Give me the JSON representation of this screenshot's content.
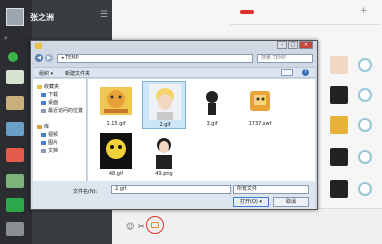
{
  "messenger": {
    "user_name": "张之洲",
    "menu_glyph": "☰",
    "search_glyph": "⌕",
    "add_glyph": "+",
    "footer_glyphs": {
      "emoji": "☺",
      "scissors": "✂"
    }
  },
  "dialog": {
    "address_path": "◂ TEMP",
    "search_placeholder": "搜索 TEMP",
    "toolbar": {
      "organize": "组织 ▾",
      "new_folder": "新建文件夹",
      "help": "?"
    },
    "window_buttons": {
      "minimize": "–",
      "maximize": "□",
      "close": "✕"
    },
    "nav": {
      "back": "◀",
      "forward": "▶"
    },
    "tree": [
      {
        "label": "收藏夹",
        "color": "#e8c24a"
      },
      {
        "label": "下载",
        "color": "#4a7fc8"
      },
      {
        "label": "桌面",
        "color": "#4a7fc8"
      },
      {
        "label": "最近访问的位置",
        "color": "#8a9ab0"
      },
      {
        "label": "库",
        "color": "#d9a441"
      },
      {
        "label": "视频",
        "color": "#4a7fc8"
      },
      {
        "label": "图片",
        "color": "#4a7fc8"
      },
      {
        "label": "文档",
        "color": "#8a9ab0"
      }
    ],
    "files": [
      {
        "name": "1.15.gif"
      },
      {
        "name": "2.gif"
      },
      {
        "name": "3.gif"
      },
      {
        "name": "1737.swf"
      },
      {
        "name": "48.gif"
      },
      {
        "name": "49.png"
      }
    ],
    "filename_label": "文件名(N):",
    "filename_value": "2.gif",
    "filetype_value": "所有文件",
    "open_label": "打开(O) ▾",
    "cancel_label": "取消"
  }
}
